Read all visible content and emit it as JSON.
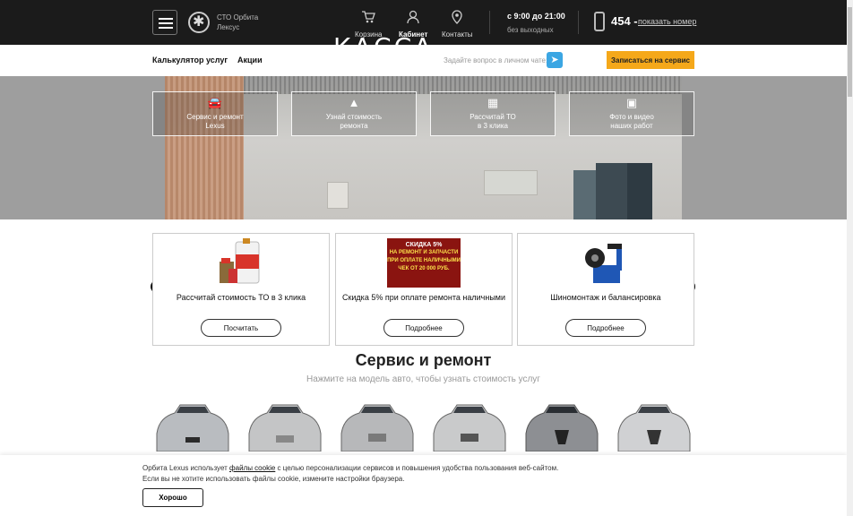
{
  "header": {
    "brand_line1": "СТО Орбита",
    "brand_line2": "Лексус",
    "nav": [
      {
        "label": "Корзина",
        "icon": "cart-icon"
      },
      {
        "label": "Кабинет",
        "icon": "user-icon"
      },
      {
        "label": "Контакты",
        "icon": "location-pin-icon"
      }
    ],
    "hours_main": "с 9:00 до 21:00",
    "hours_sub": "без выходных",
    "phone_prefix": "454 -",
    "show_number": "показать номер"
  },
  "subnav": {
    "calc": "Калькулятор услуг",
    "promo": "Акции",
    "ask": "Задайте вопрос в личном чате:",
    "cta": "Записаться на сервис"
  },
  "hero": {
    "sign": "КАССА",
    "boxes": [
      {
        "line1": "Сервис и ремонт",
        "line2": "Lexus",
        "icon": "car-icon"
      },
      {
        "line1": "Узнай стоимость",
        "line2": "ремонта",
        "icon": "road-icon"
      },
      {
        "line1": "Рассчитай ТО",
        "line2": "в 3 клика",
        "icon": "calculator-icon"
      },
      {
        "line1": "Фото и видео",
        "line2": "наших работ",
        "icon": "photo-icon"
      }
    ]
  },
  "cards": [
    {
      "title": "Рассчитай стоимость ТО в 3 клика",
      "button": "Посчитать"
    },
    {
      "title": "Скидка 5% при оплате ремонта наличными",
      "button": "Подробнее",
      "promo_lines": [
        "СКИДКА 5%",
        "НА РЕМОНТ И ЗАПЧАСТИ",
        "ПРИ ОПЛАТЕ НАЛИЧНЫМИ",
        "ЧЕК ОТ 20 000 РУБ."
      ]
    },
    {
      "title": "Шиномонтаж и балансировка",
      "button": "Подробнее"
    }
  ],
  "section": {
    "title": "Сервис и ремонт",
    "subtitle": "Нажмите на модель авто, чтобы узнать стоимость услуг"
  },
  "cookie": {
    "text1_pre": "Орбита Lexus использует",
    "text1_link": "файлы cookie",
    "text1_post": "с целью персонализации сервисов и повышения удобства пользования веб-сайтом.",
    "text2": "Если вы не хотите использовать файлы cookie, измените настройки браузера.",
    "ok": "Хорошо"
  },
  "colors": {
    "accent": "#f5a81a",
    "header_bg": "#1b1b1b",
    "telegram": "#3ba6e3"
  }
}
